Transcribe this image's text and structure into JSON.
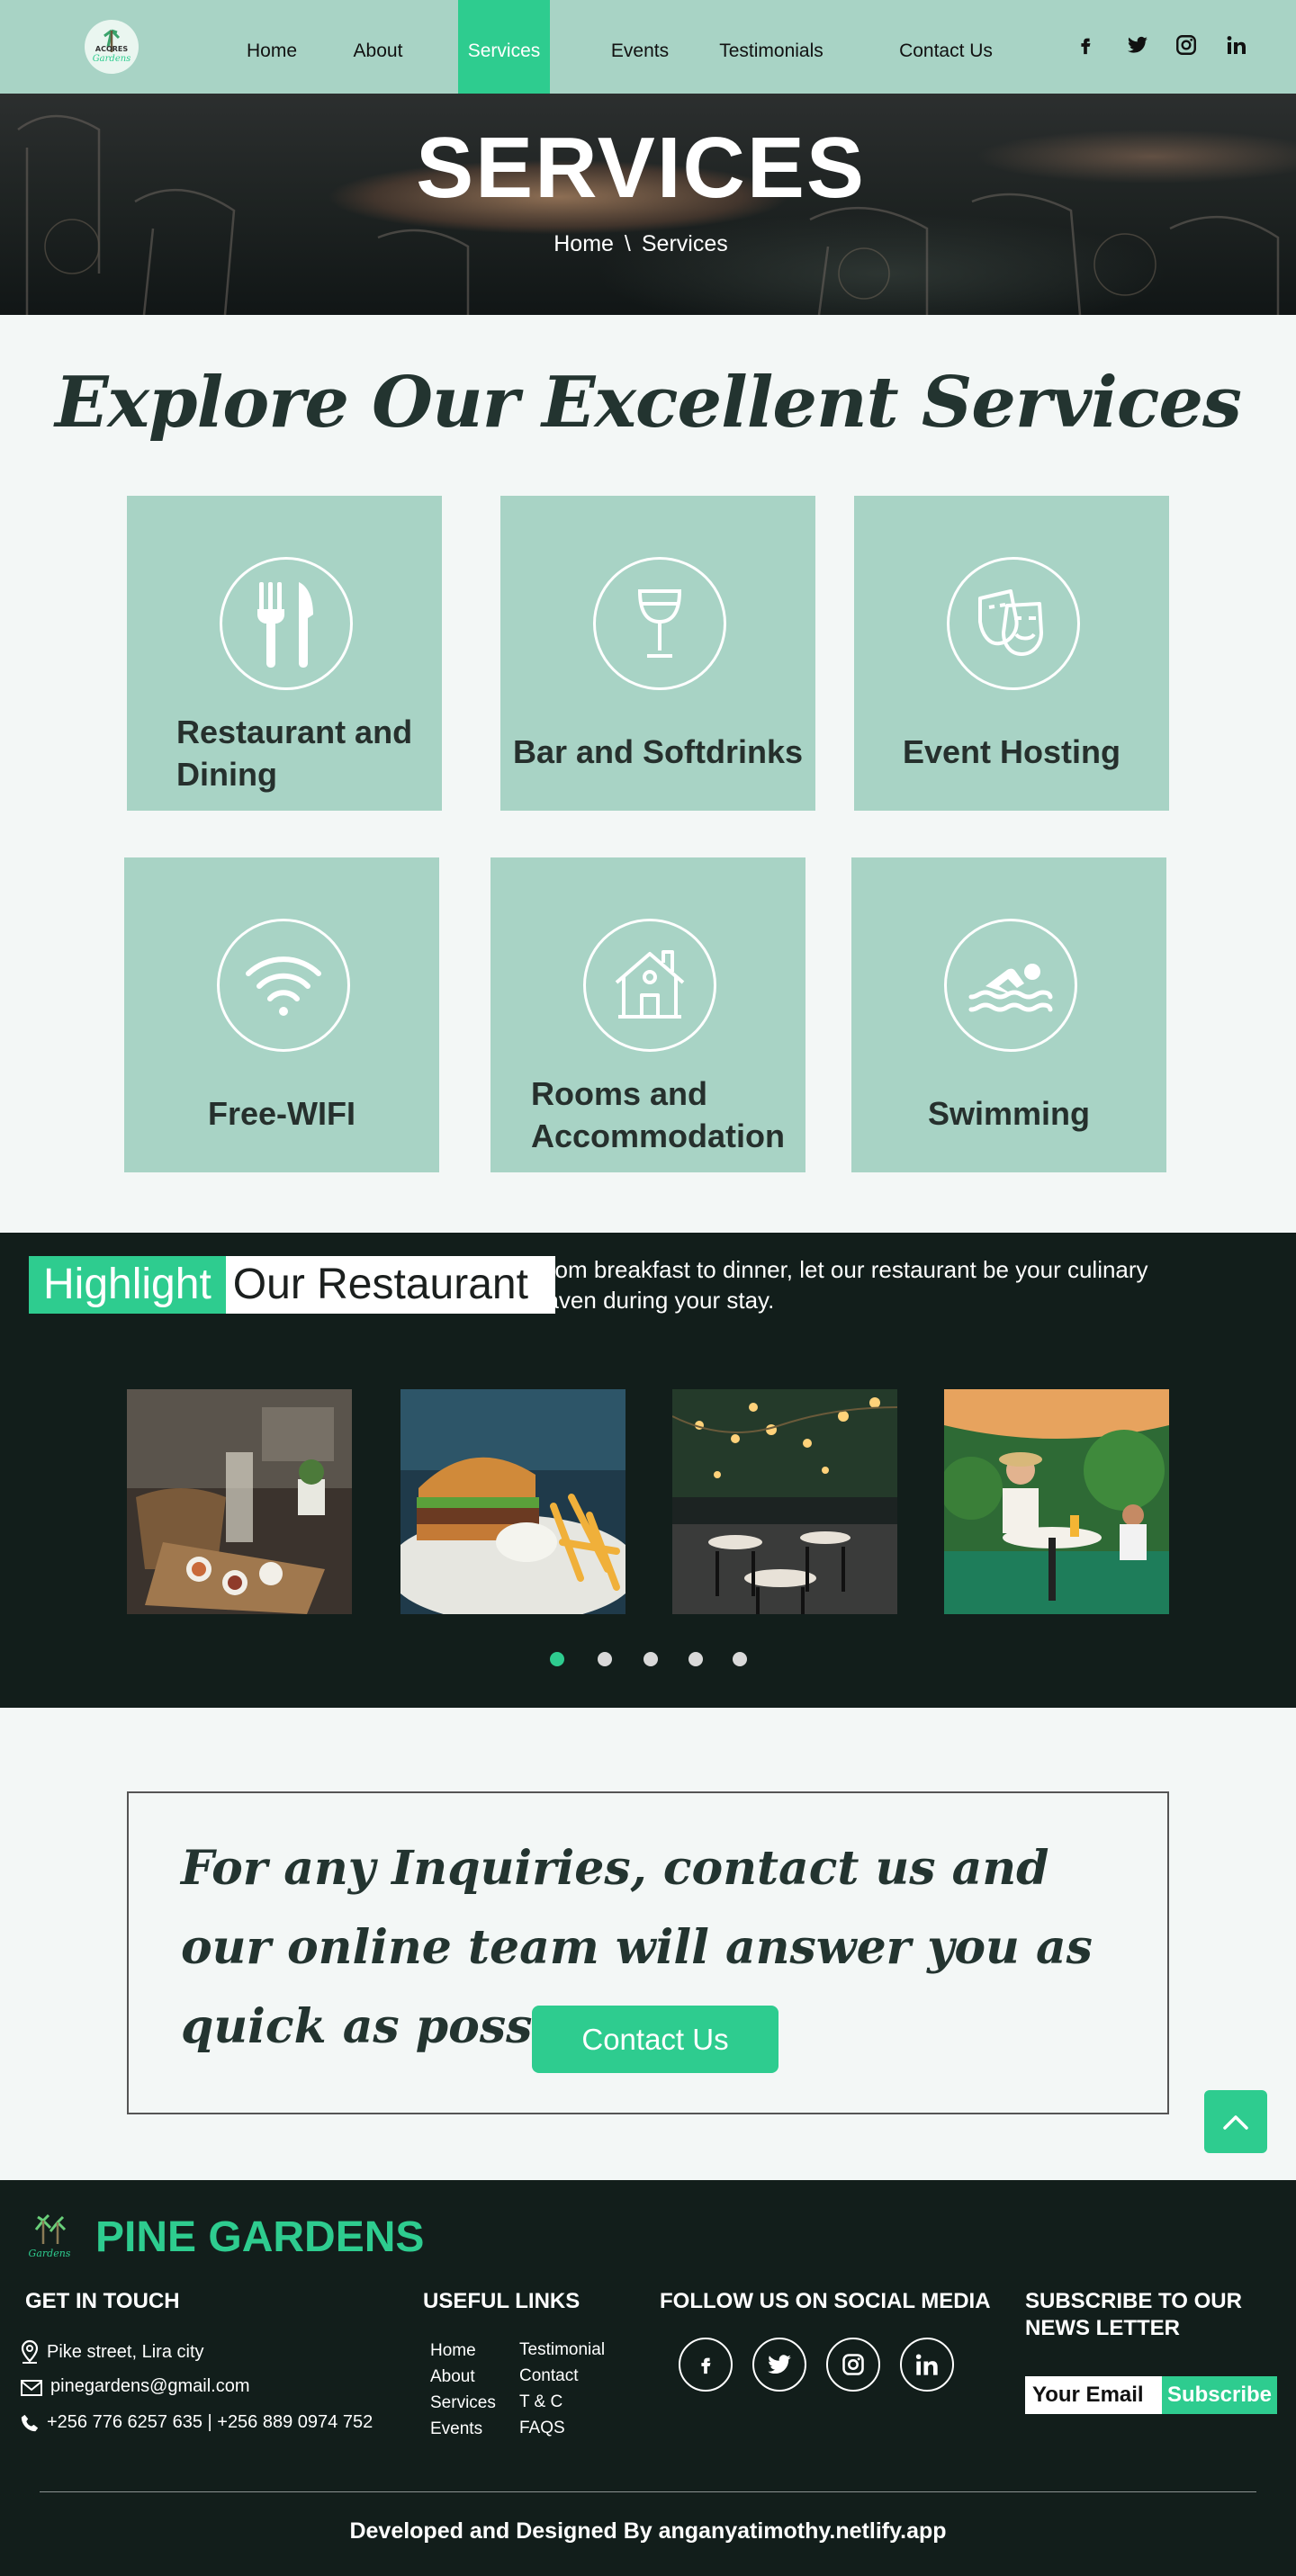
{
  "nav": {
    "logo_text": [
      "ACORES",
      "Gardens"
    ],
    "items": [
      "Home",
      "About",
      "Services",
      "Events",
      "Testimonials",
      "Contact Us"
    ],
    "active_item": "Services",
    "social_icons": [
      "facebook-icon",
      "twitter-icon",
      "instagram-icon",
      "linkedin-icon"
    ]
  },
  "hero": {
    "title": "SERVICES",
    "breadcrumb_home": "Home",
    "breadcrumb_sep": "\\",
    "breadcrumb_current": "Services"
  },
  "services": {
    "heading": "Explore Our Excellent Services",
    "cards": [
      {
        "label": "Restaurant and Dining",
        "icon": "fork-knife-icon"
      },
      {
        "label": "Bar and Softdrinks",
        "icon": "wine-glass-icon"
      },
      {
        "label": "Event Hosting",
        "icon": "theater-masks-icon"
      },
      {
        "label": "Free-WIFI",
        "icon": "wifi-icon"
      },
      {
        "label": "Rooms and Accommodation",
        "icon": "house-icon"
      },
      {
        "label": "Swimming",
        "icon": "swimmer-icon"
      }
    ]
  },
  "highlight": {
    "title_green": "Highlight",
    "title_white": "Our Restaurant",
    "description": "From breakfast to dinner, let our restaurant be your culinary haven during your stay.",
    "photos": [
      "platter-photo",
      "burger-photo",
      "terrace-photo",
      "garden-dining-photo"
    ],
    "slides_total": 5,
    "active_slide": 1
  },
  "inquiry": {
    "text": "For any Inquiries, contact us and our online team will answer you as quick as possible",
    "button": "Contact Us"
  },
  "footer": {
    "brand": "PINE GARDENS",
    "get_in_touch": "GET IN TOUCH",
    "address": "Pike street, Lira city",
    "email": "pinegardens@gmail.com",
    "phone": "+256 776 6257 635 | +256 889 0974 752",
    "useful_links_heading": "USEFUL LINKS",
    "useful_links_col1": [
      "Home",
      "About",
      "Services",
      "Events"
    ],
    "useful_links_col2": [
      "Testimonial",
      "Contact",
      "T & C",
      "FAQS"
    ],
    "social_heading": "FOLLOW US ON SOCIAL MEDIA",
    "subscribe_heading_line1": "SUBSCRIBE TO OUR",
    "subscribe_heading_line2": "NEWS LETTER",
    "subscribe_placeholder": "Your Email",
    "subscribe_button": "Subscribe",
    "credit": "Developed and Designed By anganyatimothy.netlify.app"
  },
  "colors": {
    "accent": "#2ecc8f",
    "nav_bg": "#a8d3c5",
    "dark_bg": "#121e1b",
    "card_bg": "#a8d3c5"
  }
}
